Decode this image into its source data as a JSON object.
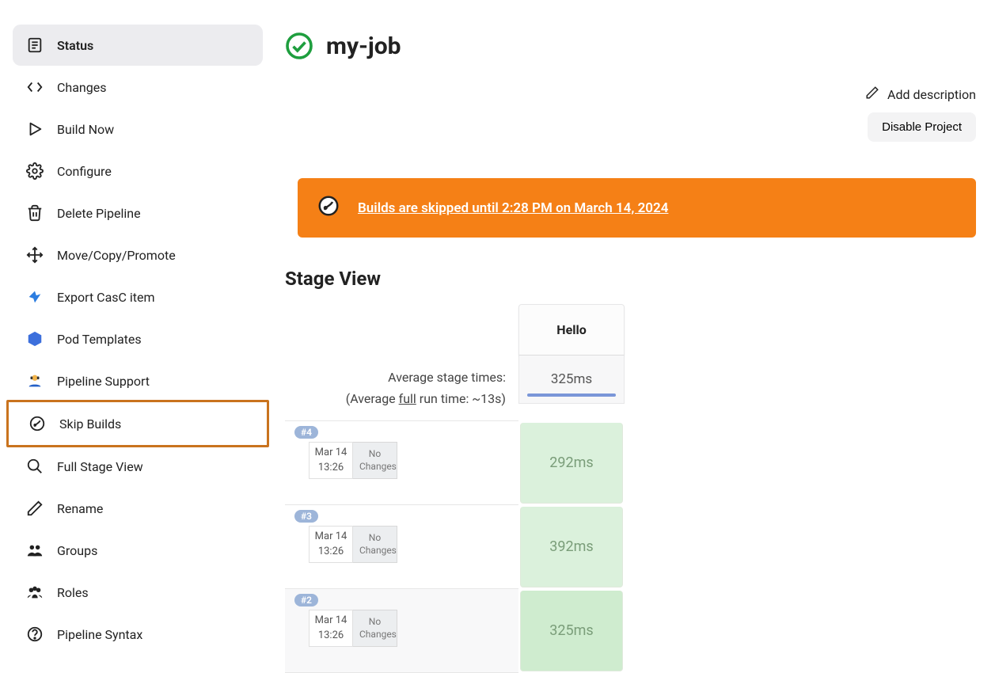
{
  "sidebar": {
    "items": [
      {
        "label": "Status"
      },
      {
        "label": "Changes"
      },
      {
        "label": "Build Now"
      },
      {
        "label": "Configure"
      },
      {
        "label": "Delete Pipeline"
      },
      {
        "label": "Move/Copy/Promote"
      },
      {
        "label": "Export CasC item"
      },
      {
        "label": "Pod Templates"
      },
      {
        "label": "Pipeline Support"
      },
      {
        "label": "Skip Builds"
      },
      {
        "label": "Full Stage View"
      },
      {
        "label": "Rename"
      },
      {
        "label": "Groups"
      },
      {
        "label": "Roles"
      },
      {
        "label": "Pipeline Syntax"
      }
    ]
  },
  "header": {
    "title": "my-job",
    "add_description": "Add description",
    "disable_project": "Disable Project"
  },
  "banner": {
    "message": "Builds are skipped until 2:28 PM on March 14, 2024"
  },
  "stage_view": {
    "title": "Stage View",
    "column": "Hello",
    "avg_label_line1": "Average stage times:",
    "avg_label_line2_prefix": "(Average ",
    "avg_label_line2_mid": "full",
    "avg_label_line2_suffix": " run time: ~13s)",
    "avg_value": "325ms",
    "builds": [
      {
        "id": "#4",
        "date": "Mar 14",
        "time": "13:26",
        "changes_l1": "No",
        "changes_l2": "Changes",
        "duration": "292ms",
        "shade": "light",
        "bg": ""
      },
      {
        "id": "#3",
        "date": "Mar 14",
        "time": "13:26",
        "changes_l1": "No",
        "changes_l2": "Changes",
        "duration": "392ms",
        "shade": "light",
        "bg": ""
      },
      {
        "id": "#2",
        "date": "Mar 14",
        "time": "13:26",
        "changes_l1": "No",
        "changes_l2": "Changes",
        "duration": "325ms",
        "shade": "mid",
        "bg": "shaded"
      }
    ]
  }
}
